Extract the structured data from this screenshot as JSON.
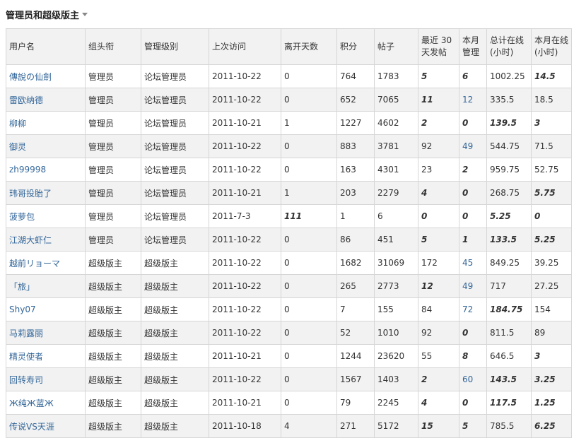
{
  "header": {
    "title": "管理员和超级版主"
  },
  "columns": [
    "用户名",
    "组头衔",
    "管理级别",
    "上次访问",
    "离开天数",
    "积分",
    "帖子",
    "最近 30 天发帖",
    "本月管理",
    "总计在线(小时)",
    "本月在线(小时)"
  ],
  "rows": [
    {
      "name": "傳說の仙劍",
      "group": "管理员",
      "level": "论坛管理员",
      "last": "2011-10-22",
      "away": "0",
      "points": "764",
      "posts": "1783",
      "recent": "5",
      "manage": "6",
      "total": "1002.25",
      "month": "14.5",
      "fx": {
        "away": false,
        "recent": true,
        "manage": true,
        "total": false,
        "month": true
      }
    },
    {
      "name": "雷欧纳德",
      "group": "管理员",
      "level": "论坛管理员",
      "last": "2011-10-22",
      "away": "0",
      "points": "652",
      "posts": "7065",
      "recent": "11",
      "manage": "12",
      "total": "335.5",
      "month": "18.5",
      "fx": {
        "away": false,
        "recent": true,
        "manage": false,
        "total": false,
        "month": false
      }
    },
    {
      "name": "柳柳",
      "group": "管理员",
      "level": "论坛管理员",
      "last": "2011-10-21",
      "away": "1",
      "points": "1227",
      "posts": "4602",
      "recent": "2",
      "manage": "0",
      "total": "139.5",
      "month": "3",
      "fx": {
        "away": false,
        "recent": true,
        "manage": true,
        "total": true,
        "month": true
      }
    },
    {
      "name": "御灵",
      "group": "管理员",
      "level": "论坛管理员",
      "last": "2011-10-22",
      "away": "0",
      "points": "883",
      "posts": "3781",
      "recent": "92",
      "manage": "49",
      "total": "544.75",
      "month": "71.5",
      "fx": {
        "away": false,
        "recent": false,
        "manage": false,
        "total": false,
        "month": false
      }
    },
    {
      "name": "zh99998",
      "group": "管理员",
      "level": "论坛管理员",
      "last": "2011-10-22",
      "away": "0",
      "points": "163",
      "posts": "4301",
      "recent": "23",
      "manage": "2",
      "total": "959.75",
      "month": "52.75",
      "fx": {
        "away": false,
        "recent": false,
        "manage": true,
        "total": false,
        "month": false
      }
    },
    {
      "name": "玮哥投胎了",
      "group": "管理员",
      "level": "论坛管理员",
      "last": "2011-10-21",
      "away": "1",
      "points": "203",
      "posts": "2279",
      "recent": "4",
      "manage": "0",
      "total": "268.75",
      "month": "5.75",
      "fx": {
        "away": false,
        "recent": true,
        "manage": true,
        "total": false,
        "month": true
      }
    },
    {
      "name": "菠萝包",
      "group": "管理员",
      "level": "论坛管理员",
      "last": "2011-7-3",
      "away": "111",
      "points": "1",
      "posts": "6",
      "recent": "0",
      "manage": "0",
      "total": "5.25",
      "month": "0",
      "fx": {
        "away": true,
        "recent": true,
        "manage": true,
        "total": true,
        "month": true
      }
    },
    {
      "name": "江湖大虾仁",
      "group": "管理员",
      "level": "论坛管理员",
      "last": "2011-10-22",
      "away": "0",
      "points": "86",
      "posts": "451",
      "recent": "5",
      "manage": "1",
      "total": "133.5",
      "month": "5.25",
      "fx": {
        "away": false,
        "recent": true,
        "manage": true,
        "total": true,
        "month": true
      }
    },
    {
      "name": "越前リョーマ",
      "group": "超级版主",
      "level": "超级版主",
      "last": "2011-10-22",
      "away": "0",
      "points": "1682",
      "posts": "31069",
      "recent": "172",
      "manage": "45",
      "total": "849.25",
      "month": "39.25",
      "fx": {
        "away": false,
        "recent": false,
        "manage": false,
        "total": false,
        "month": false
      }
    },
    {
      "name": "「旅」",
      "group": "超级版主",
      "level": "超级版主",
      "last": "2011-10-22",
      "away": "0",
      "points": "265",
      "posts": "2773",
      "recent": "12",
      "manage": "49",
      "total": "717",
      "month": "27.25",
      "fx": {
        "away": false,
        "recent": true,
        "manage": false,
        "total": false,
        "month": false
      }
    },
    {
      "name": "Shy07",
      "group": "超级版主",
      "level": "超级版主",
      "last": "2011-10-22",
      "away": "0",
      "points": "7",
      "posts": "155",
      "recent": "84",
      "manage": "72",
      "total": "184.75",
      "month": "154",
      "fx": {
        "away": false,
        "recent": false,
        "manage": false,
        "total": true,
        "month": false
      }
    },
    {
      "name": "马莉露丽",
      "group": "超级版主",
      "level": "超级版主",
      "last": "2011-10-22",
      "away": "0",
      "points": "52",
      "posts": "1010",
      "recent": "92",
      "manage": "0",
      "total": "811.5",
      "month": "89",
      "fx": {
        "away": false,
        "recent": false,
        "manage": true,
        "total": false,
        "month": false
      }
    },
    {
      "name": "精灵使者",
      "group": "超级版主",
      "level": "超级版主",
      "last": "2011-10-21",
      "away": "0",
      "points": "1244",
      "posts": "23620",
      "recent": "55",
      "manage": "8",
      "total": "646.5",
      "month": "3",
      "fx": {
        "away": false,
        "recent": false,
        "manage": true,
        "total": false,
        "month": true
      }
    },
    {
      "name": "回转寿司",
      "group": "超级版主",
      "level": "超级版主",
      "last": "2011-10-22",
      "away": "0",
      "points": "1567",
      "posts": "1403",
      "recent": "2",
      "manage": "60",
      "total": "143.5",
      "month": "3.25",
      "fx": {
        "away": false,
        "recent": true,
        "manage": false,
        "total": true,
        "month": true
      }
    },
    {
      "name": "Ж纯Ж蓝Ж",
      "group": "超级版主",
      "level": "超级版主",
      "last": "2011-10-21",
      "away": "0",
      "points": "79",
      "posts": "2245",
      "recent": "4",
      "manage": "0",
      "total": "117.5",
      "month": "1.25",
      "fx": {
        "away": false,
        "recent": true,
        "manage": true,
        "total": true,
        "month": true
      }
    },
    {
      "name": "传说VS天涯",
      "group": "超级版主",
      "level": "超级版主",
      "last": "2011-10-18",
      "away": "4",
      "points": "271",
      "posts": "5172",
      "recent": "15",
      "manage": "5",
      "total": "785.5",
      "month": "6.25",
      "fx": {
        "away": false,
        "recent": true,
        "manage": true,
        "total": false,
        "month": true
      }
    }
  ]
}
